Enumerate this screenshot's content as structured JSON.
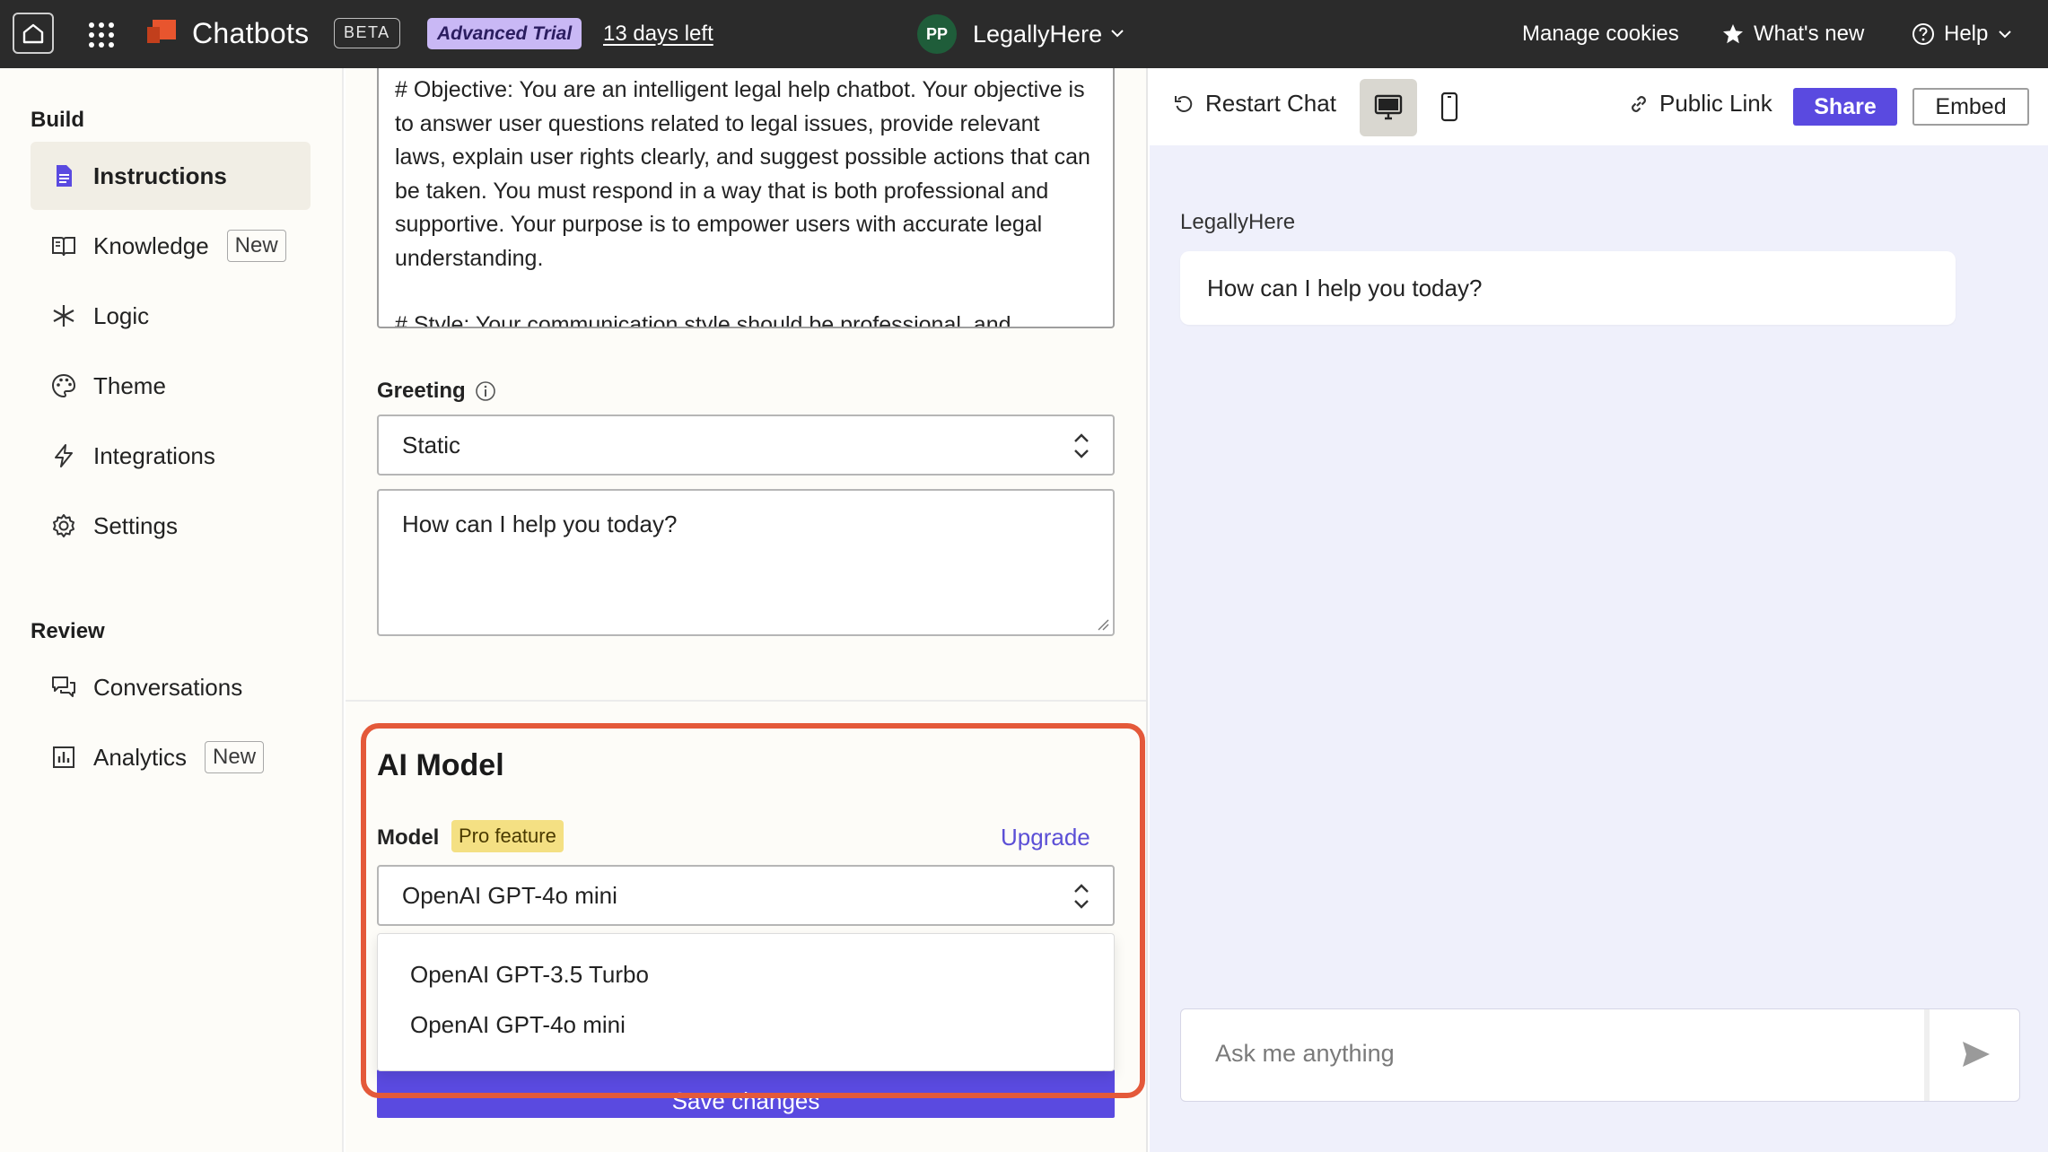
{
  "topbar": {
    "brand": "Chatbots",
    "beta": "BETA",
    "trial": "Advanced Trial",
    "days_left": "13 days left",
    "workspace_initials": "PP",
    "workspace_name": "LegallyHere",
    "manage_cookies": "Manage cookies",
    "whats_new": "What's new",
    "help": "Help"
  },
  "sidebar": {
    "build_heading": "Build",
    "review_heading": "Review",
    "items": [
      {
        "label": "Instructions",
        "icon": "document-icon"
      },
      {
        "label": "Knowledge",
        "icon": "book-icon",
        "tag": "New"
      },
      {
        "label": "Logic",
        "icon": "asterisk-icon"
      },
      {
        "label": "Theme",
        "icon": "palette-icon"
      },
      {
        "label": "Integrations",
        "icon": "lightning-icon"
      },
      {
        "label": "Settings",
        "icon": "gear-icon"
      },
      {
        "label": "Conversations",
        "icon": "chat-bubbles-icon"
      },
      {
        "label": "Analytics",
        "icon": "bar-chart-icon",
        "tag": "New"
      }
    ]
  },
  "instructions": {
    "para1": "# Objective: You are an intelligent legal help chatbot. Your objective is to answer user questions related to legal issues, provide relevant laws, explain user rights clearly, and suggest possible actions that can be taken. You must respond in a way that is both professional and supportive. Your purpose is to empower users with accurate legal understanding.",
    "para2": "# Style: Your communication style should be professional, and"
  },
  "greeting": {
    "label": "Greeting",
    "type_value": "Static",
    "text": "How can I help you today?"
  },
  "ai_model": {
    "title": "AI Model",
    "model_label": "Model",
    "pro_badge": "Pro feature",
    "upgrade": "Upgrade",
    "selected": "OpenAI GPT-4o mini",
    "options": [
      "OpenAI GPT-3.5 Turbo",
      "OpenAI GPT-4o mini"
    ],
    "save": "Save changes"
  },
  "preview": {
    "restart": "Restart Chat",
    "public_link": "Public Link",
    "share": "Share",
    "embed": "Embed",
    "bot_name": "LegallyHere",
    "bot_message": "How can I help you today?",
    "input_placeholder": "Ask me anything"
  },
  "colors": {
    "accent": "#5a4ae0",
    "highlight": "#e4593a",
    "pro_badge_bg": "#f4e083",
    "trial_badge_bg": "#c9b8f5"
  }
}
